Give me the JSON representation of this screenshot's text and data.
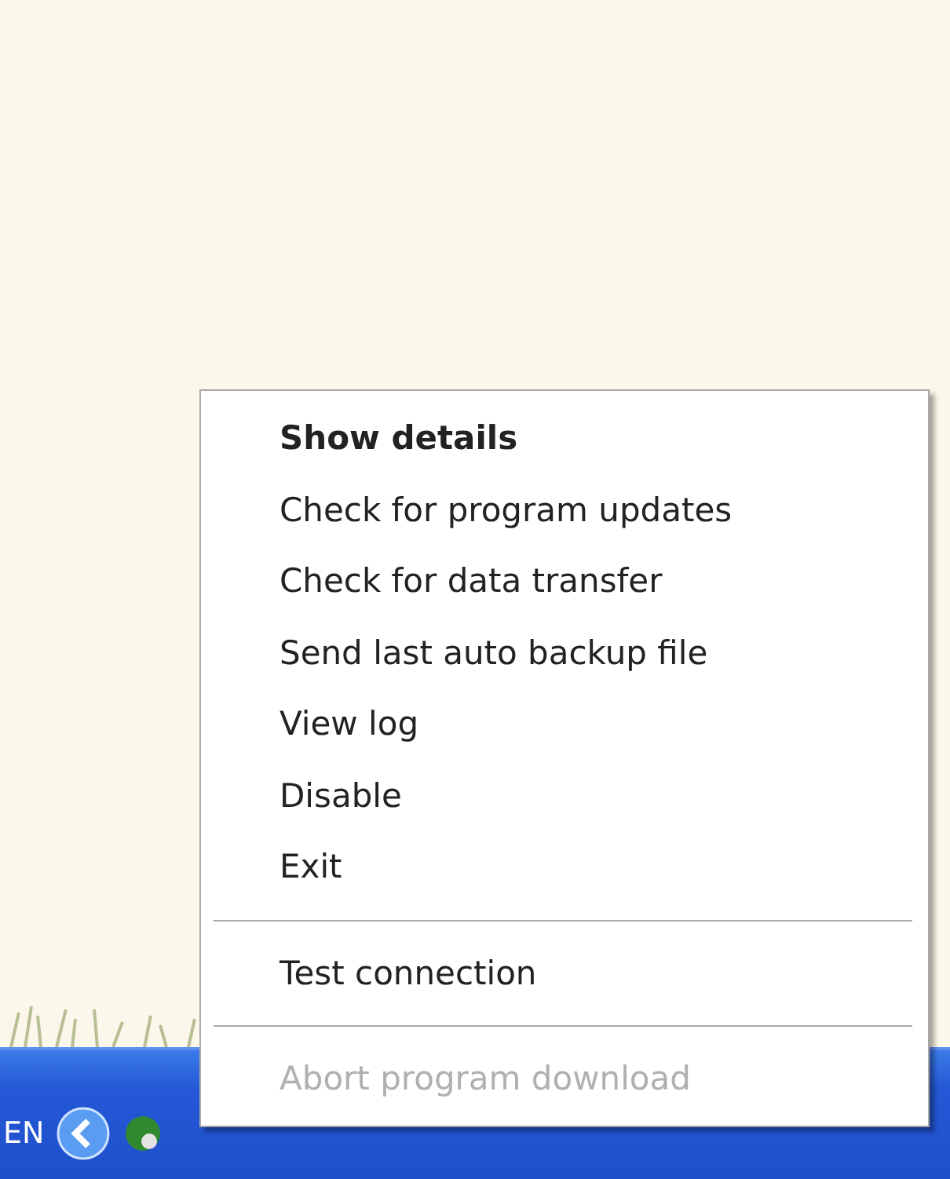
{
  "context_menu": {
    "items": [
      {
        "kind": "item",
        "label": "Show details",
        "default": true,
        "disabled": false
      },
      {
        "kind": "item",
        "label": "Check for program updates",
        "default": false,
        "disabled": false
      },
      {
        "kind": "item",
        "label": "Check for data transfer",
        "default": false,
        "disabled": false
      },
      {
        "kind": "item",
        "label": "Send last auto backup file",
        "default": false,
        "disabled": false
      },
      {
        "kind": "item",
        "label": "View log",
        "default": false,
        "disabled": false
      },
      {
        "kind": "item",
        "label": "Disable",
        "default": false,
        "disabled": false
      },
      {
        "kind": "item",
        "label": "Exit",
        "default": false,
        "disabled": false
      },
      {
        "kind": "separator"
      },
      {
        "kind": "item",
        "label": "Test connection",
        "default": false,
        "disabled": false
      },
      {
        "kind": "separator"
      },
      {
        "kind": "item",
        "label": "Abort program download",
        "default": false,
        "disabled": true
      }
    ]
  },
  "taskbar": {
    "language": "EN"
  }
}
